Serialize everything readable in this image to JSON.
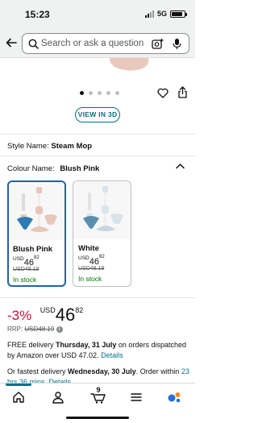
{
  "status_bar": {
    "time": "15:23",
    "network": "5G",
    "battery_level": 0.85
  },
  "search": {
    "placeholder": "Search or ask a question"
  },
  "carousel": {
    "dot_count": 5,
    "active_index": 0
  },
  "view_in_3d_label": "VIEW IN 3D",
  "style": {
    "label": "Style Name:",
    "value": "Steam Mop"
  },
  "colour": {
    "label": "Colour Name:",
    "value": "Blush Pink"
  },
  "swatches": [
    {
      "name": "Blush Pink",
      "currency": "USD",
      "price_whole": "46",
      "price_fraction": "82",
      "was_price": "USD48.19",
      "stock": "In stock",
      "accent_color": "#e8c6b8",
      "selected": true
    },
    {
      "name": "White",
      "currency": "USD",
      "price_whole": "46",
      "price_fraction": "82",
      "was_price": "USD48.19",
      "stock": "In stock",
      "accent_color": "#d9e3ea",
      "selected": false
    }
  ],
  "price": {
    "discount": "-3%",
    "currency": "USD",
    "whole": "46",
    "fraction": "82",
    "rrp_label": "RRP:",
    "rrp_value": "USD48.19"
  },
  "delivery": {
    "free_prefix": "FREE delivery",
    "free_date": "Thursday, 31 July",
    "free_suffix": "on orders dispatched by Amazon over USD 47.02.",
    "free_link": "Details",
    "fast_prefix": "Or fastest delivery",
    "fast_date": "Wednesday, 30 July",
    "fast_suffix": ". Order within",
    "fast_time": "23 hrs 36 mins.",
    "fast_link": "Details"
  },
  "bottom_nav": {
    "cart_count": "9",
    "active_item": "home"
  },
  "colors": {
    "accent_link": "#007185",
    "discount_red": "#cc0c39",
    "in_stock_green": "#007600",
    "selected_border": "#2162a1"
  }
}
